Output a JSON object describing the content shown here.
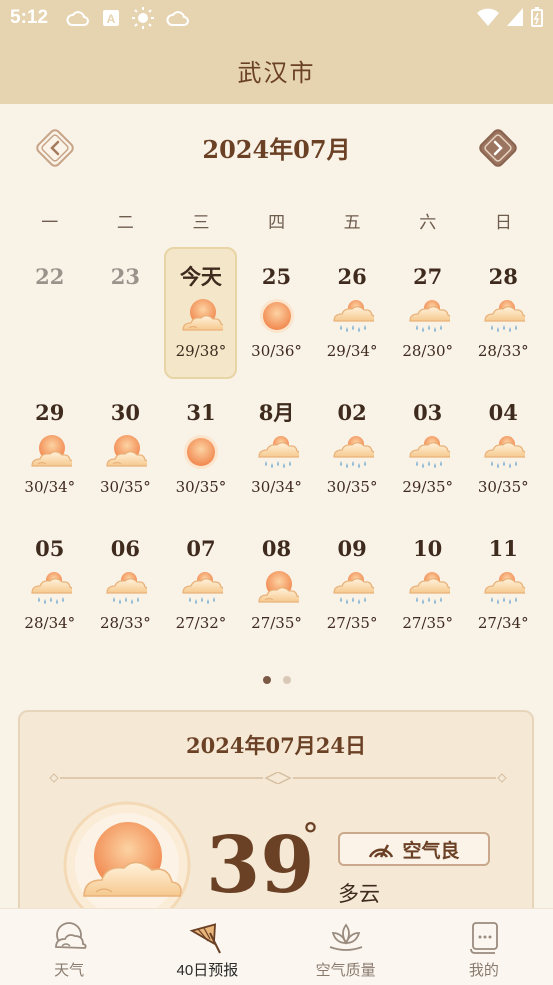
{
  "status_bar": {
    "time": "5:12"
  },
  "header": {
    "city": "武汉市"
  },
  "calendar": {
    "month_title": "2024年07月",
    "weekdays": [
      "一",
      "二",
      "三",
      "四",
      "五",
      "六",
      "日"
    ],
    "weeks": [
      [
        {
          "num": "22",
          "icon": "",
          "temp": "",
          "past": true
        },
        {
          "num": "23",
          "icon": "",
          "temp": "",
          "past": true
        },
        {
          "num": "今天",
          "icon": "partly-cloudy-icon",
          "temp": "29/38°",
          "today": true
        },
        {
          "num": "25",
          "icon": "sun-icon",
          "temp": "30/36°"
        },
        {
          "num": "26",
          "icon": "rain-icon",
          "temp": "29/34°"
        },
        {
          "num": "27",
          "icon": "rain-icon",
          "temp": "28/30°"
        },
        {
          "num": "28",
          "icon": "rain-icon",
          "temp": "28/33°"
        }
      ],
      [
        {
          "num": "29",
          "icon": "partly-cloudy-icon",
          "temp": "30/34°"
        },
        {
          "num": "30",
          "icon": "partly-cloudy-icon",
          "temp": "30/35°"
        },
        {
          "num": "31",
          "icon": "sun-icon",
          "temp": "30/35°"
        },
        {
          "num": "8月",
          "icon": "rain-icon",
          "temp": "30/34°"
        },
        {
          "num": "02",
          "icon": "rain-icon",
          "temp": "30/35°"
        },
        {
          "num": "03",
          "icon": "rain-icon",
          "temp": "29/35°"
        },
        {
          "num": "04",
          "icon": "rain-icon",
          "temp": "30/35°"
        }
      ],
      [
        {
          "num": "05",
          "icon": "rain-icon",
          "temp": "28/34°"
        },
        {
          "num": "06",
          "icon": "rain-icon",
          "temp": "28/33°"
        },
        {
          "num": "07",
          "icon": "rain-icon",
          "temp": "27/32°"
        },
        {
          "num": "08",
          "icon": "partly-cloudy-icon",
          "temp": "27/35°"
        },
        {
          "num": "09",
          "icon": "rain-icon",
          "temp": "27/35°"
        },
        {
          "num": "10",
          "icon": "rain-icon",
          "temp": "27/35°"
        },
        {
          "num": "11",
          "icon": "rain-icon",
          "temp": "27/34°"
        }
      ]
    ]
  },
  "detail": {
    "date": "2024年07月24日",
    "temperature": "39",
    "degree_symbol": "°",
    "air_quality": "空气良",
    "condition": "多云"
  },
  "bottom_nav": [
    {
      "label": "天气",
      "icon": "weather-cloud-icon",
      "active": false
    },
    {
      "label": "40日预报",
      "icon": "umbrella-icon",
      "active": true
    },
    {
      "label": "空气质量",
      "icon": "lotus-icon",
      "active": false
    },
    {
      "label": "我的",
      "icon": "scroll-icon",
      "active": false
    }
  ],
  "colors": {
    "header_bg": "#e6d3b0",
    "accent_brown": "#6b4126",
    "sun_orange": "#f49a5c"
  }
}
